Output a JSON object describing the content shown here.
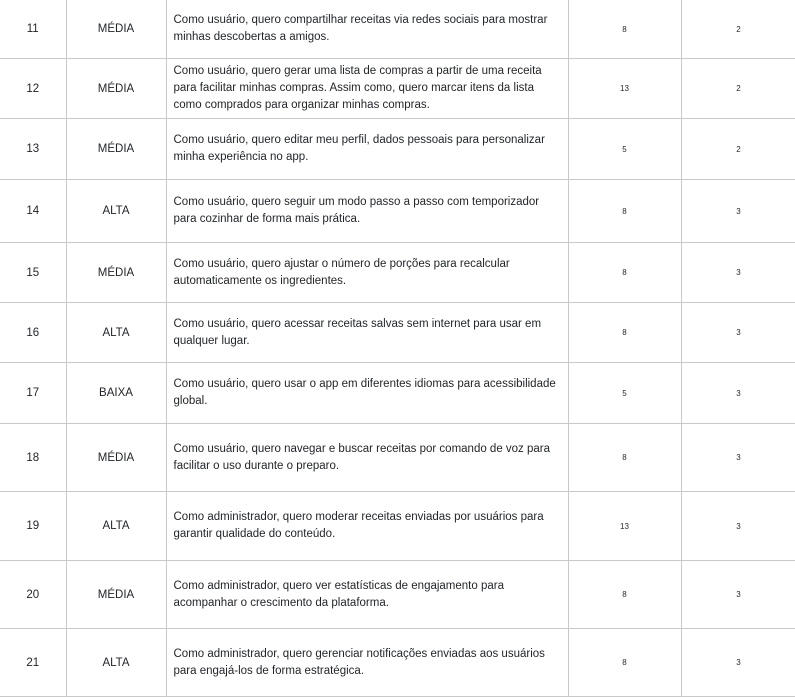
{
  "rows": [
    {
      "id": "11",
      "priority": "MÉDIA",
      "description": "Como usuário, quero compartilhar receitas via redes sociais para mostrar minhas descobertas a amigos.",
      "points": "8",
      "sprint": "2"
    },
    {
      "id": "12",
      "priority": "MÉDIA",
      "description": "Como usuário, quero gerar uma lista de compras a partir de uma receita para facilitar minhas compras. Assim como, quero marcar itens da lista como comprados para organizar minhas compras.",
      "points": "13",
      "sprint": "2"
    },
    {
      "id": "13",
      "priority": "MÉDIA",
      "description": "Como usuário, quero editar meu perfil, dados pessoais  para personalizar minha experiência no app.",
      "points": "5",
      "sprint": "2"
    },
    {
      "id": "14",
      "priority": "ALTA",
      "description": "Como usuário, quero seguir um modo passo a passo com temporizador para cozinhar de forma mais prática.",
      "points": "8",
      "sprint": "3"
    },
    {
      "id": "15",
      "priority": "MÉDIA",
      "description": "Como usuário, quero ajustar o número de porções para recalcular automaticamente os ingredientes.",
      "points": "8",
      "sprint": "3"
    },
    {
      "id": "16",
      "priority": "ALTA",
      "description": "Como usuário, quero acessar receitas salvas sem internet para usar em qualquer lugar.",
      "points": "8",
      "sprint": "3"
    },
    {
      "id": "17",
      "priority": "BAIXA",
      "description": "Como usuário, quero usar o app em diferentes idiomas para acessibilidade global.",
      "points": "5",
      "sprint": "3"
    },
    {
      "id": "18",
      "priority": "MÉDIA",
      "description": "Como usuário, quero navegar e buscar receitas por comando de voz para facilitar o uso durante o preparo.",
      "points": "8",
      "sprint": "3"
    },
    {
      "id": "19",
      "priority": "ALTA",
      "description": "Como administrador, quero moderar receitas enviadas por usuários para garantir qualidade do conteúdo.",
      "points": "13",
      "sprint": "3"
    },
    {
      "id": "20",
      "priority": "MÉDIA",
      "description": "Como administrador, quero ver estatísticas de engajamento para acompanhar o crescimento da plataforma.",
      "points": "8",
      "sprint": "3"
    },
    {
      "id": "21",
      "priority": "ALTA",
      "description": "Como administrador, quero gerenciar notificações enviadas aos usuários para engajá-los de forma estratégica.",
      "points": "8",
      "sprint": "3"
    }
  ]
}
